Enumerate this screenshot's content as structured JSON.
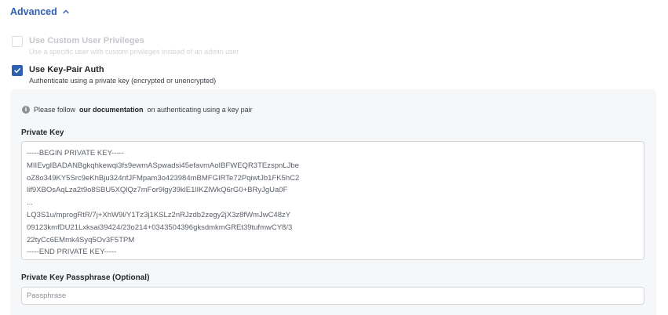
{
  "advanced": {
    "label": "Advanced",
    "expanded": true
  },
  "custom_privileges": {
    "label": "Use Custom User Privileges",
    "description": "Use a specific user with custom privileges instead of an admin user",
    "checked": false,
    "disabled": true
  },
  "key_pair_auth": {
    "label": "Use Key-Pair Auth",
    "description": "Authenticate using a private key (encrypted or unencrypted)",
    "checked": true
  },
  "info": {
    "prefix": "Please follow",
    "link": "our documentation",
    "suffix": "on authenticating using a key pair"
  },
  "private_key": {
    "label": "Private Key",
    "value": "-----BEGIN PRIVATE KEY-----\nMIIEvgIBADANBgkqhkewqi3fs9ewmASpwadsi45efavmAoIBFWEQR3TEzspnLJbe\noZ8o349KY5Src9eKhBju324nfJFMpam3o423984mBMFGIRTe72PqiwtJb1FK5hC2\nlif9XBOsAqLza2t9o8SBU5XQlQz7mFor9lgy39klE1lIKZlWkQ6rG0+BRyJgUa0F\n...\nLQ3S1u/mprogRtR/7j+XhW9l/Y1Tz3j1KSLz2nRJzdb2zegy2jX3z8fWmJwC48zY\n09123kmfDU21Lxksai39424/23o214+0343504396gksdmkmGREt39tufmwCY8/3\n22tyCc6EMmk4Syq5Ov3F5TPM\n-----END PRIVATE KEY-----"
  },
  "passphrase": {
    "label": "Private Key Passphrase (Optional)",
    "placeholder": "Passphrase",
    "value": ""
  }
}
